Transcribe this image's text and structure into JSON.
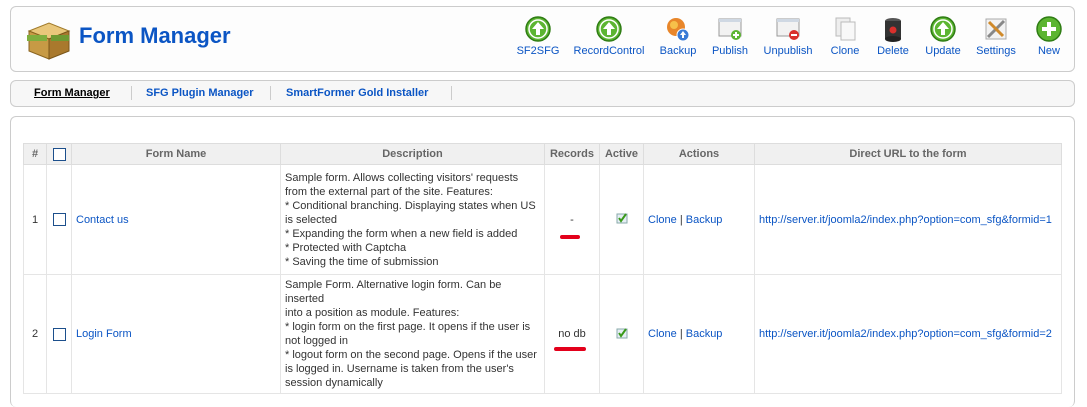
{
  "header": {
    "title": "Form Manager"
  },
  "toolbar": [
    {
      "id": "sf2sfg",
      "label": "SF2SFG",
      "icon": "up-arrow-icon"
    },
    {
      "id": "recordcontrol",
      "label": "RecordControl",
      "icon": "up-arrow-icon"
    },
    {
      "id": "backup",
      "label": "Backup",
      "icon": "backup-icon"
    },
    {
      "id": "publish",
      "label": "Publish",
      "icon": "publish-icon"
    },
    {
      "id": "unpublish",
      "label": "Unpublish",
      "icon": "unpublish-icon"
    },
    {
      "id": "clone",
      "label": "Clone",
      "icon": "clone-icon"
    },
    {
      "id": "delete",
      "label": "Delete",
      "icon": "trash-icon"
    },
    {
      "id": "update",
      "label": "Update",
      "icon": "up-arrow-icon"
    },
    {
      "id": "settings",
      "label": "Settings",
      "icon": "settings-icon"
    },
    {
      "id": "new",
      "label": "New",
      "icon": "plus-icon"
    }
  ],
  "submenu": [
    {
      "label": "Form Manager",
      "active": true
    },
    {
      "label": "SFG Plugin Manager",
      "active": false
    },
    {
      "label": "SmartFormer Gold Installer",
      "active": false
    }
  ],
  "table": {
    "headers": {
      "num": "#",
      "name": "Form Name",
      "description": "Description",
      "records": "Records",
      "active": "Active",
      "actions": "Actions",
      "url": "Direct URL to the form"
    },
    "rows": [
      {
        "num": "1",
        "name": "Contact us",
        "description": [
          "Sample form. Allows collecting visitors' requests",
          "from the external part of the site. Features:",
          "* Conditional branching. Displaying states when US",
          "is selected",
          "* Expanding the form when a new field is added",
          "* Protected with Captcha",
          "* Saving the time of submission"
        ],
        "records": "-",
        "clone": "Clone",
        "separator": "|",
        "backup": "Backup",
        "url": "http://server.it/joomla2/index.php?option=com_sfg&formid=1"
      },
      {
        "num": "2",
        "name": "Login Form",
        "description": [
          "Sample Form. Alternative login form. Can be inserted",
          "into a position as module. Features:",
          "* login form on the first page. It opens if the user is",
          "not logged in",
          "* logout form on the second page. Opens if the user",
          "is logged in. Username is taken from the user's",
          "session dynamically"
        ],
        "records": "no db",
        "clone": "Clone",
        "separator": "|",
        "backup": "Backup",
        "url": "http://server.it/joomla2/index.php?option=com_sfg&formid=2"
      }
    ]
  },
  "colors": {
    "link": "#0b55c4",
    "accent_green": "#5cb531",
    "mark_red": "#e3001b"
  }
}
